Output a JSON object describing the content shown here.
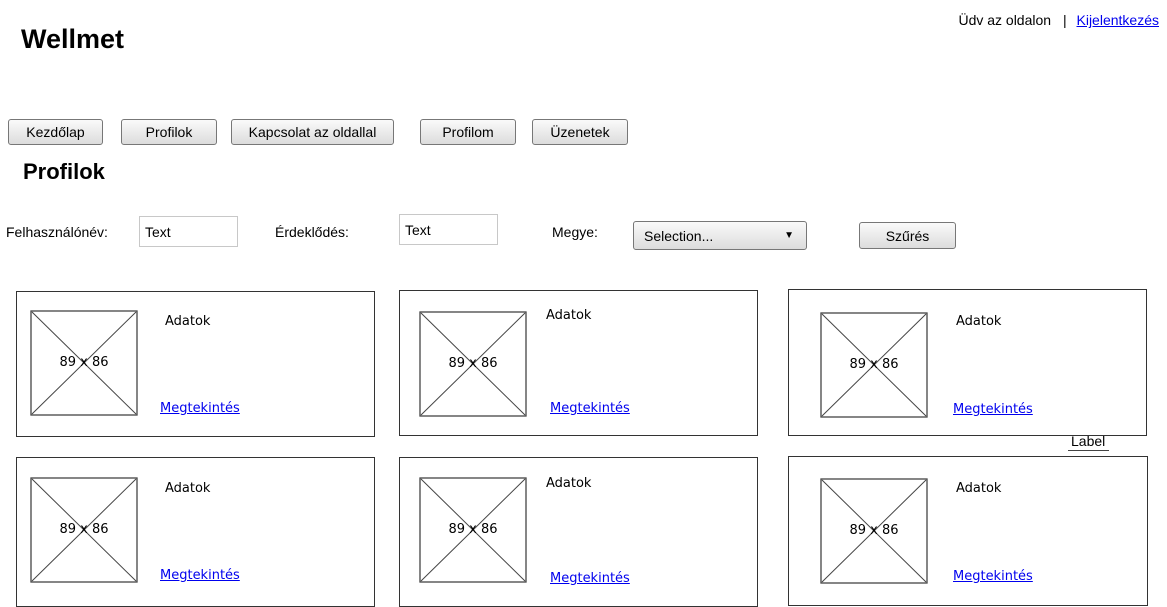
{
  "header": {
    "site_title": "Wellmet",
    "welcome_text": "Üdv az oldalon",
    "separator": "|",
    "logout_link": "Kijelentkezés"
  },
  "nav": {
    "items": [
      {
        "label": "Kezdőlap"
      },
      {
        "label": "Profilok"
      },
      {
        "label": "Kapcsolat az oldallal"
      },
      {
        "label": "Profilom"
      },
      {
        "label": "Üzenetek"
      }
    ]
  },
  "main": {
    "title": "Profilok"
  },
  "filters": {
    "username_label": "Felhasználónév:",
    "username_value": "Text",
    "interest_label": "Érdeklődés:",
    "interest_value": "Text",
    "county_label": "Megye:",
    "county_value": "Selection...",
    "filter_button": "Szűrés"
  },
  "profiles": [
    {
      "image_label": "89 x 86",
      "details": "Adatok",
      "view_link": "Megtekintés"
    },
    {
      "image_label": "89 x 86",
      "details": "Adatok",
      "view_link": "Megtekintés"
    },
    {
      "image_label": "89 x 86",
      "details": "Adatok",
      "view_link": "Megtekintés"
    },
    {
      "image_label": "89 x 86",
      "details": "Adatok",
      "view_link": "Megtekintés"
    },
    {
      "image_label": "89 x 86",
      "details": "Adatok",
      "view_link": "Megtekintés"
    },
    {
      "image_label": "89 x 86",
      "details": "Adatok",
      "view_link": "Megtekintés"
    }
  ],
  "extra_label": "Label",
  "icons": {
    "image_placeholder": "image-placeholder-icon",
    "dropdown": "chevron-down-icon"
  }
}
